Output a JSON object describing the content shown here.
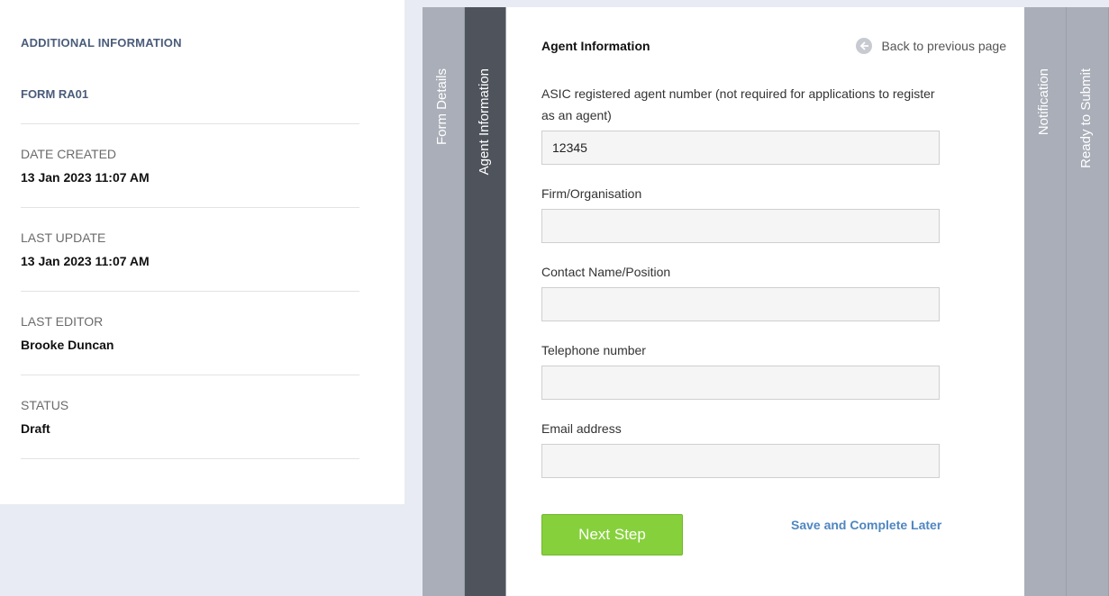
{
  "info": {
    "heading": "ADDITIONAL INFORMATION",
    "form": "FORM RA01",
    "date_created_label": "DATE CREATED",
    "date_created_value": "13 Jan 2023 11:07 AM",
    "last_update_label": "LAST UPDATE",
    "last_update_value": "13 Jan 2023 11:07 AM",
    "last_editor_label": "LAST EDITOR",
    "last_editor_value": "Brooke Duncan",
    "status_label": "STATUS",
    "status_value": "Draft"
  },
  "steps": [
    {
      "label": "Form Details",
      "active": false
    },
    {
      "label": "Agent Information",
      "active": true
    },
    {
      "label": "Notification",
      "active": false
    },
    {
      "label": "Ready to Submit",
      "active": false
    }
  ],
  "main": {
    "title": "Agent Information",
    "back_label": "Back to previous page",
    "fields": [
      {
        "label": "ASIC registered agent number (not required for applications to register as an agent)",
        "value": "12345"
      },
      {
        "label": "Firm/Organisation",
        "value": ""
      },
      {
        "label": "Contact Name/Position",
        "value": ""
      },
      {
        "label": "Telephone number",
        "value": ""
      },
      {
        "label": "Email address",
        "value": ""
      }
    ],
    "next_label": "Next Step",
    "save_later_label": "Save and Complete Later"
  },
  "colors": {
    "accent_green": "#86d13b",
    "link_blue": "#4f86c0",
    "tab_active": "#4f545c",
    "tab_inactive": "#a9aeb8"
  }
}
